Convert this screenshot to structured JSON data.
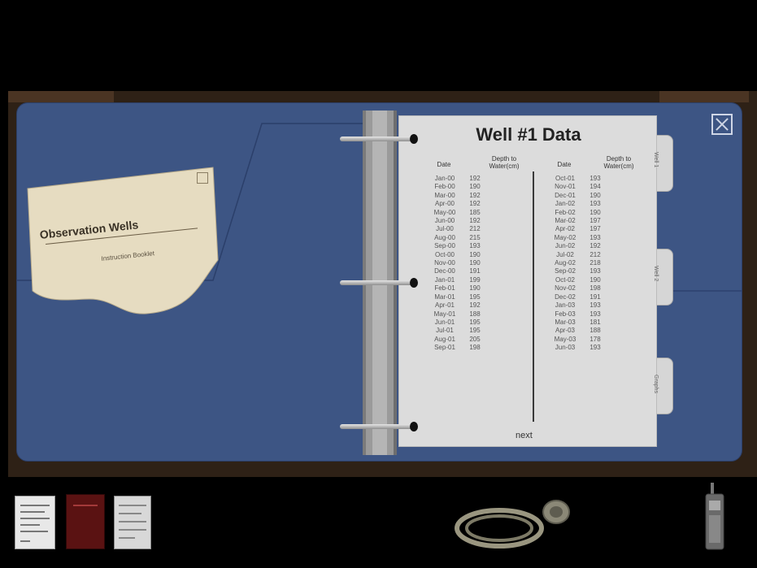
{
  "page": {
    "title": "Well #1 Data",
    "next_label": "next",
    "columns_left": {
      "date_header": "Date",
      "depth_header": "Depth to Water(cm)"
    },
    "columns_right": {
      "date_header": "Date",
      "depth_header": "Depth to Water(cm)"
    },
    "rows_left": [
      {
        "date": "Jan-00",
        "depth": "192"
      },
      {
        "date": "Feb-00",
        "depth": "190"
      },
      {
        "date": "Mar-00",
        "depth": "192"
      },
      {
        "date": "Apr-00",
        "depth": "192"
      },
      {
        "date": "May-00",
        "depth": "185"
      },
      {
        "date": "Jun-00",
        "depth": "192"
      },
      {
        "date": "Jul-00",
        "depth": "212"
      },
      {
        "date": "Aug-00",
        "depth": "215"
      },
      {
        "date": "Sep-00",
        "depth": "193"
      },
      {
        "date": "Oct-00",
        "depth": "190"
      },
      {
        "date": "Nov-00",
        "depth": "190"
      },
      {
        "date": "Dec-00",
        "depth": "191"
      },
      {
        "date": "Jan-01",
        "depth": "199"
      },
      {
        "date": "Feb-01",
        "depth": "190"
      },
      {
        "date": "Mar-01",
        "depth": "195"
      },
      {
        "date": "Apr-01",
        "depth": "192"
      },
      {
        "date": "May-01",
        "depth": "188"
      },
      {
        "date": "Jun-01",
        "depth": "195"
      },
      {
        "date": "Jul-01",
        "depth": "195"
      },
      {
        "date": "Aug-01",
        "depth": "205"
      },
      {
        "date": "Sep-01",
        "depth": "198"
      }
    ],
    "rows_right": [
      {
        "date": "Oct-01",
        "depth": "193"
      },
      {
        "date": "Nov-01",
        "depth": "194"
      },
      {
        "date": "Dec-01",
        "depth": "190"
      },
      {
        "date": "Jan-02",
        "depth": "193"
      },
      {
        "date": "Feb-02",
        "depth": "190"
      },
      {
        "date": "Mar-02",
        "depth": "197"
      },
      {
        "date": "Apr-02",
        "depth": "197"
      },
      {
        "date": "May-02",
        "depth": "193"
      },
      {
        "date": "Jun-02",
        "depth": "192"
      },
      {
        "date": "Jul-02",
        "depth": "212"
      },
      {
        "date": "Aug-02",
        "depth": "218"
      },
      {
        "date": "Sep-02",
        "depth": "193"
      },
      {
        "date": "Oct-02",
        "depth": "190"
      },
      {
        "date": "Nov-02",
        "depth": "198"
      },
      {
        "date": "Dec-02",
        "depth": "191"
      },
      {
        "date": "Jan-03",
        "depth": "193"
      },
      {
        "date": "Feb-03",
        "depth": "193"
      },
      {
        "date": "Mar-03",
        "depth": "181"
      },
      {
        "date": "Apr-03",
        "depth": "188"
      },
      {
        "date": "May-03",
        "depth": "178"
      },
      {
        "date": "Jun-03",
        "depth": "193"
      }
    ],
    "tabs": [
      "Well 1",
      "Well 2",
      "Graphs"
    ]
  },
  "booklet": {
    "title": "Observation Wells",
    "subtitle": "Instruction Booklet"
  },
  "inventory": {
    "items": [
      "document-icon",
      "red-notebook-icon",
      "data-sheet-icon",
      "measuring-tape-icon",
      "walkie-talkie-icon"
    ]
  },
  "colors": {
    "binder": "#3d5584",
    "page": "#dcdcdc",
    "booklet": "#e6dcc1",
    "background": "#000000"
  }
}
